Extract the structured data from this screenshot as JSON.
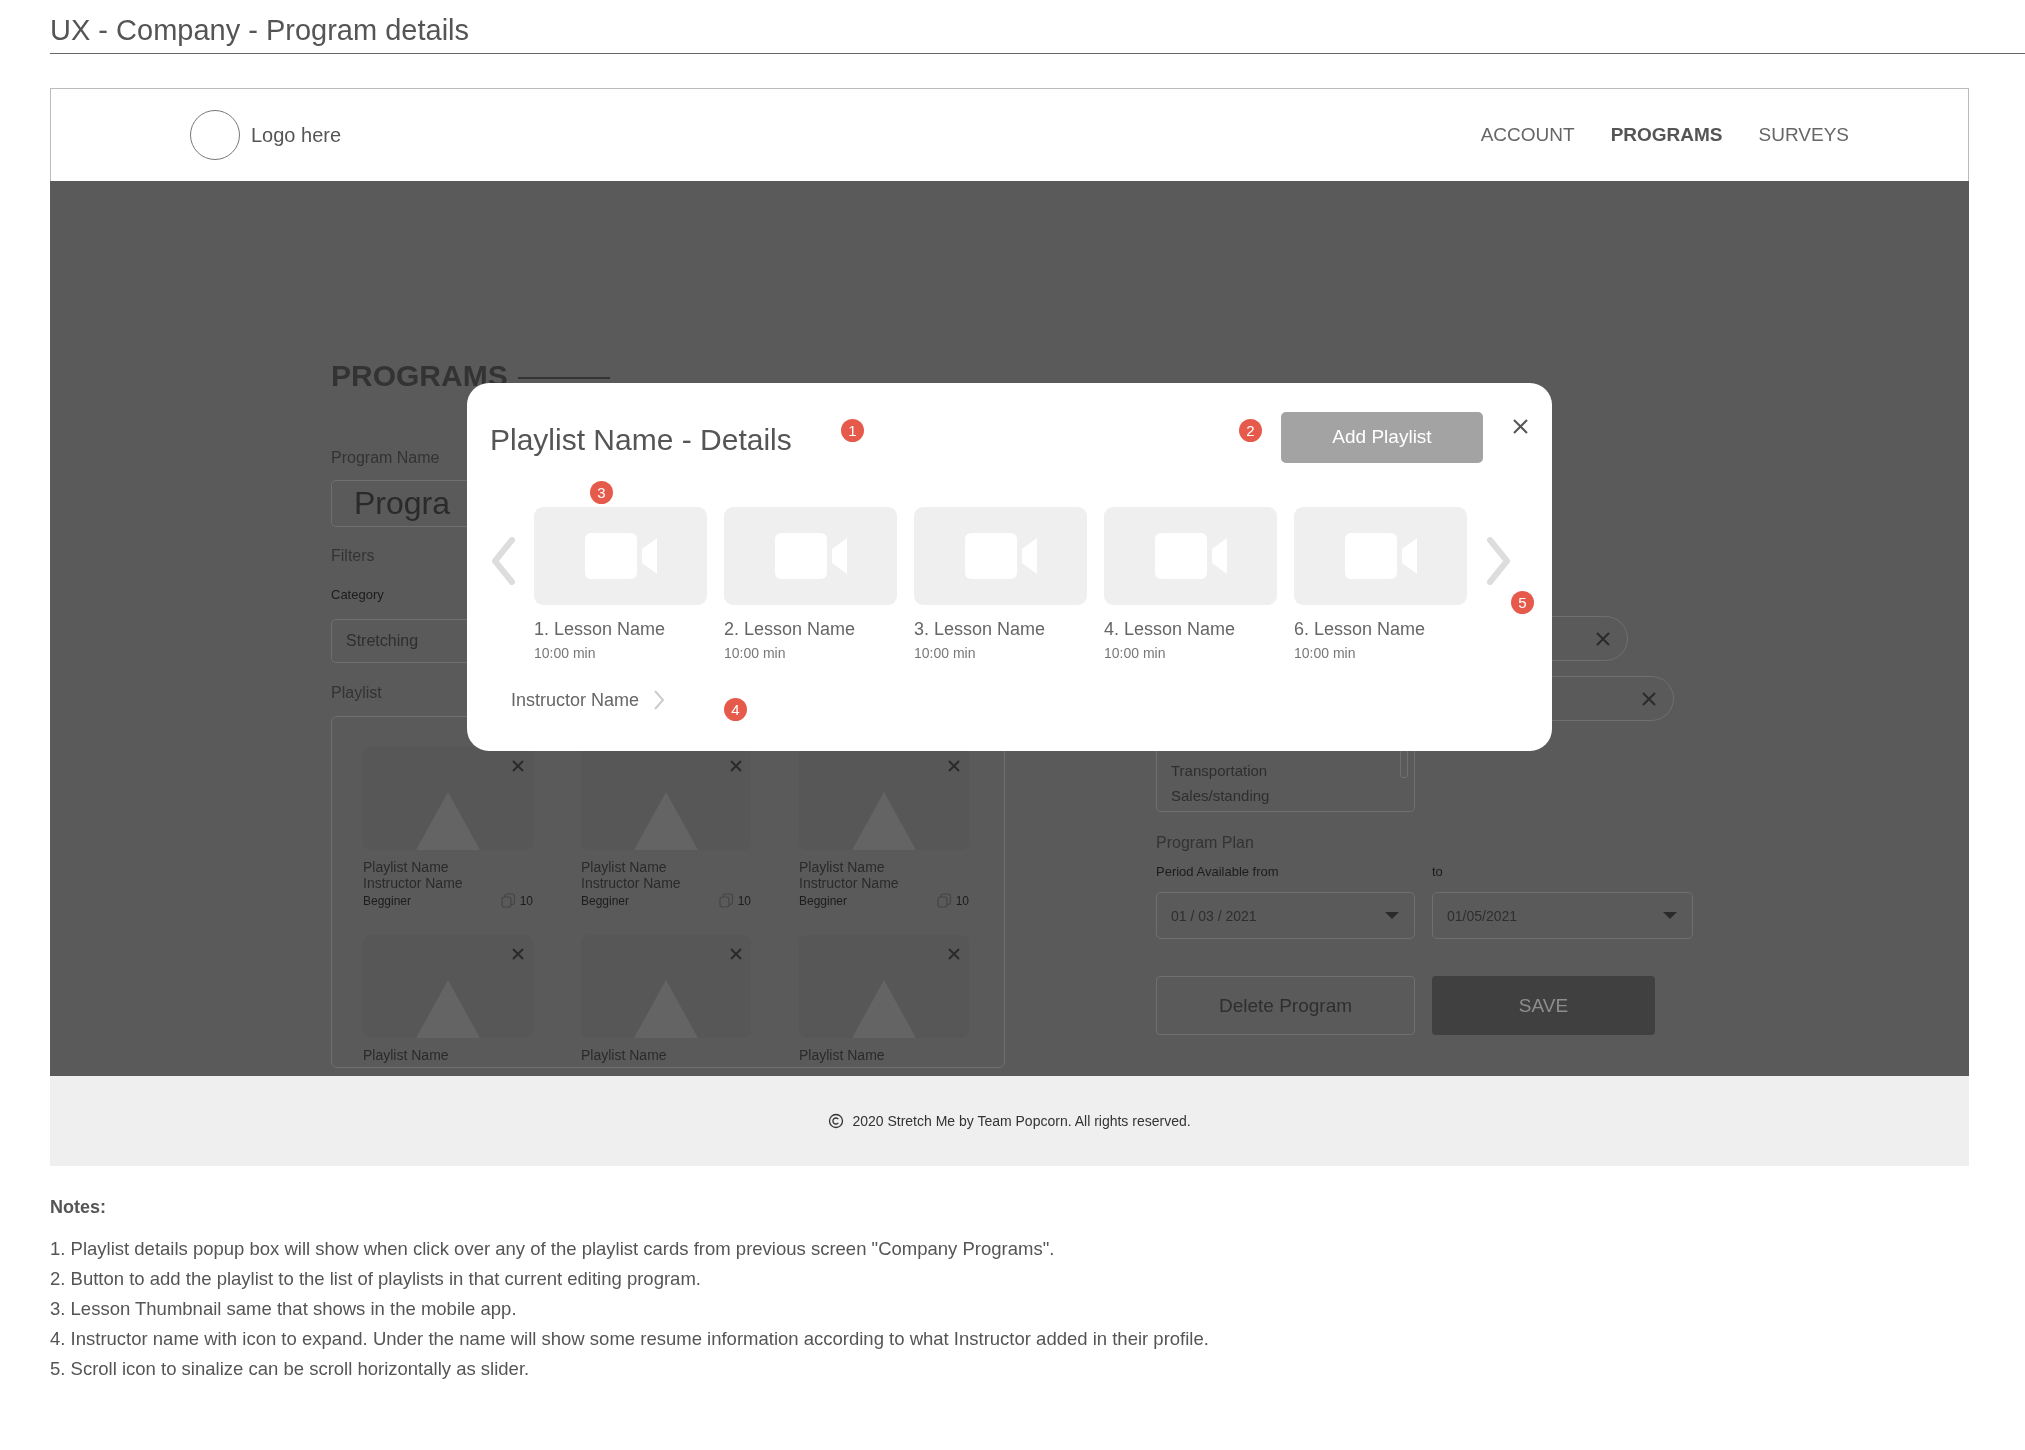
{
  "page_title": "UX - Company - Program details",
  "header": {
    "logo_text": "Logo here",
    "nav": [
      {
        "label": "ACCOUNT",
        "selected": false
      },
      {
        "label": "PROGRAMS",
        "selected": true
      },
      {
        "label": "SURVEYS",
        "selected": false
      }
    ]
  },
  "form": {
    "heading": "PROGRAMS",
    "program_name_label": "Program Name",
    "program_name_value": "Progra",
    "filters_label": "Filters",
    "category_label": "Category",
    "category_value": "Stretching",
    "playlist_label": "Playlist",
    "playlists": [
      {
        "name": "Playlist Name",
        "instructor": "Instructor Name",
        "level": "Begginer",
        "count": "10"
      },
      {
        "name": "Playlist Name",
        "instructor": "Instructor Name",
        "level": "Begginer",
        "count": "10"
      },
      {
        "name": "Playlist Name",
        "instructor": "Instructor Name",
        "level": "Begginer",
        "count": "10"
      },
      {
        "name": "Playlist Name"
      },
      {
        "name": "Playlist Name"
      },
      {
        "name": "Playlist Name"
      }
    ],
    "list_items": [
      "Transportation",
      "Sales/standing"
    ],
    "program_plan_label": "Program Plan",
    "from_label": "Period Available from",
    "to_label": "to",
    "date_from": "01 / 03 / 2021",
    "date_to": "01/05/2021",
    "buttons": [
      {
        "label": "Delete Program",
        "kind": "secondary"
      },
      {
        "label": "SAVE",
        "kind": "primary"
      }
    ]
  },
  "modal": {
    "title": "Playlist Name - Details",
    "add_button": "Add Playlist",
    "lessons": [
      {
        "name": "1. Lesson Name",
        "duration": "10:00 min"
      },
      {
        "name": "2. Lesson Name",
        "duration": "10:00 min"
      },
      {
        "name": "3. Lesson Name",
        "duration": "10:00 min"
      },
      {
        "name": "4. Lesson Name",
        "duration": "10:00 min"
      },
      {
        "name": "6. Lesson Name",
        "duration": "10:00 min"
      }
    ],
    "instructor": "Instructor Name",
    "markers": [
      "1",
      "2",
      "3",
      "4",
      "5"
    ]
  },
  "footer": "2020 Stretch Me by Team Popcorn. All rights reserved.",
  "notes": {
    "heading": "Notes:",
    "items": [
      "1. Playlist details popup box will show when click over any of the playlist cards from previous screen \"Company Programs\".",
      "2. Button to add the playlist to the list of playlists in that current editing program.",
      "3. Lesson Thumbnail same that shows in the mobile app.",
      "4. Instructor name with icon to expand. Under the name will show some resume information according to what Instructor added in their profile.",
      "5. Scroll icon to sinalize can be scroll horizontally as slider."
    ]
  }
}
